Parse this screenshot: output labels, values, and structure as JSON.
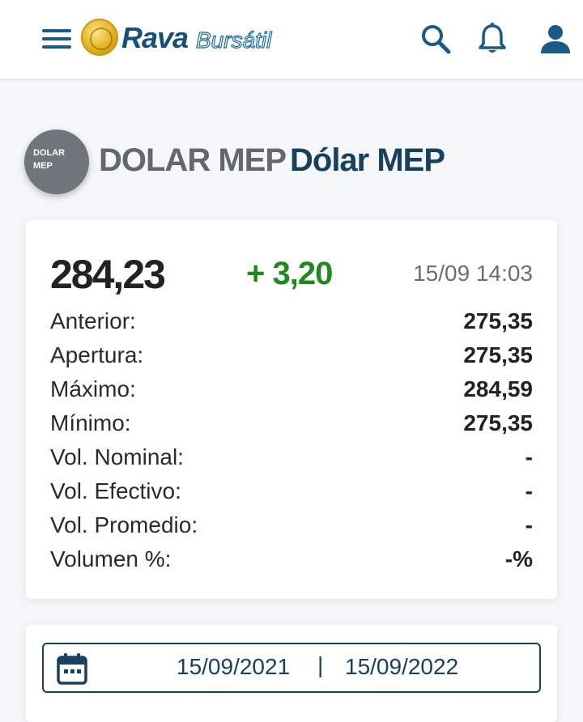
{
  "header": {
    "brand_primary": "Rava",
    "brand_secondary": "Bursátil",
    "icons": [
      "menu-icon",
      "search-icon",
      "bell-icon",
      "user-icon"
    ],
    "accent_color": "#1a5a86"
  },
  "instrument": {
    "avatar_text_line1": "DOLAR",
    "avatar_text_line2": "MEP",
    "ticker": "DOLAR MEP",
    "name": "Dólar MEP"
  },
  "quote": {
    "price": "284,23",
    "change": "+ 3,20",
    "change_color": "#1e8a1e",
    "timestamp": "15/09 14:03",
    "stats": [
      {
        "label": "Anterior:",
        "value": "275,35"
      },
      {
        "label": "Apertura:",
        "value": "275,35"
      },
      {
        "label": "Máximo:",
        "value": "284,59"
      },
      {
        "label": "Mínimo:",
        "value": "275,35"
      },
      {
        "label": "Vol. Nominal:",
        "value": "-"
      },
      {
        "label": "Vol. Efectivo:",
        "value": "-"
      },
      {
        "label": "Vol. Promedio:",
        "value": "-"
      },
      {
        "label": "Volumen %:",
        "value": "-%"
      }
    ]
  },
  "date_range": {
    "from": "15/09/2021",
    "separator": "|",
    "to": "15/09/2022"
  }
}
